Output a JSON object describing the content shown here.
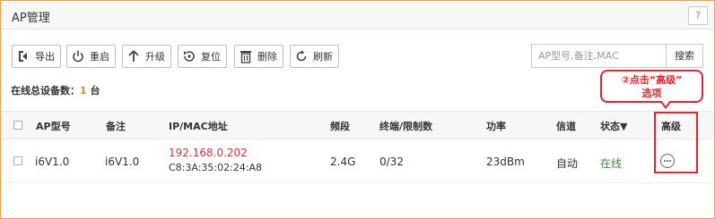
{
  "header": {
    "title": "AP管理",
    "help_label": "?"
  },
  "toolbar": {
    "export": "导出",
    "restart": "重启",
    "upgrade": "升级",
    "reset": "复位",
    "delete": "删除",
    "refresh": "刷新"
  },
  "search": {
    "placeholder": "AP型号,备注,MAC",
    "button": "搜索"
  },
  "summary": {
    "label": "在线总设备数：",
    "count": "1",
    "unit": "台"
  },
  "callout": {
    "line1": "②点击“高级”",
    "line2": "选项"
  },
  "table": {
    "columns": [
      "AP型号",
      "备注",
      "IP/MAC地址",
      "频段",
      "终端/限制数",
      "功率",
      "信道",
      "状态▼",
      "高级"
    ],
    "rows": [
      {
        "model": "i6V1.0",
        "remark": "i6V1.0",
        "ip": "192.168.0.202",
        "mac": "C8:3A:35:02:24:A8",
        "band": "2.4G",
        "clients": "0/32",
        "power": "23dBm",
        "channel": "自动",
        "status": "在线"
      }
    ]
  },
  "colors": {
    "accent": "#e08a1f",
    "ip": "#d9322f",
    "status_online": "#3c8a3c",
    "annotation": "#e5232b"
  },
  "icons": [
    "export-icon",
    "restart-icon",
    "upgrade-icon",
    "reset-icon",
    "delete-icon",
    "refresh-icon",
    "more-icon"
  ]
}
